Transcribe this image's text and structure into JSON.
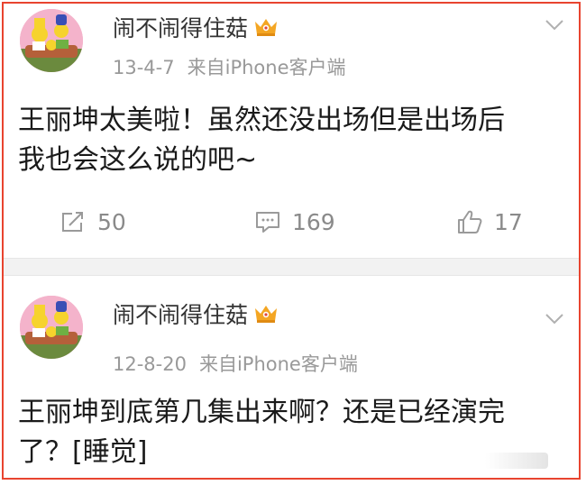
{
  "posts": [
    {
      "username": "闹不闹得住菇",
      "date": "13-4-7",
      "source": "来自iPhone客户端",
      "content_lines": [
        "王丽坤太美啦！虽然还没出场但是出场后",
        "我也会这么说的吧~"
      ],
      "reposts": "50",
      "comments": "169",
      "likes": "17"
    },
    {
      "username": "闹不闹得住菇",
      "date": "12-8-20",
      "source": "来自iPhone客户端",
      "content_lines": [
        "王丽坤到底第几集出来啊？还是已经演完",
        "了？[睡觉]"
      ]
    }
  ],
  "icons": {
    "crown": "vip-crown-icon",
    "chevron": "chevron-down-icon",
    "repost": "repost-icon",
    "comment": "comment-icon",
    "like": "thumbs-up-icon"
  },
  "colors": {
    "frame_border": "#e8442f",
    "crown": "#f4a623",
    "meta_text": "#999999",
    "action_text": "#8a8a8a"
  }
}
